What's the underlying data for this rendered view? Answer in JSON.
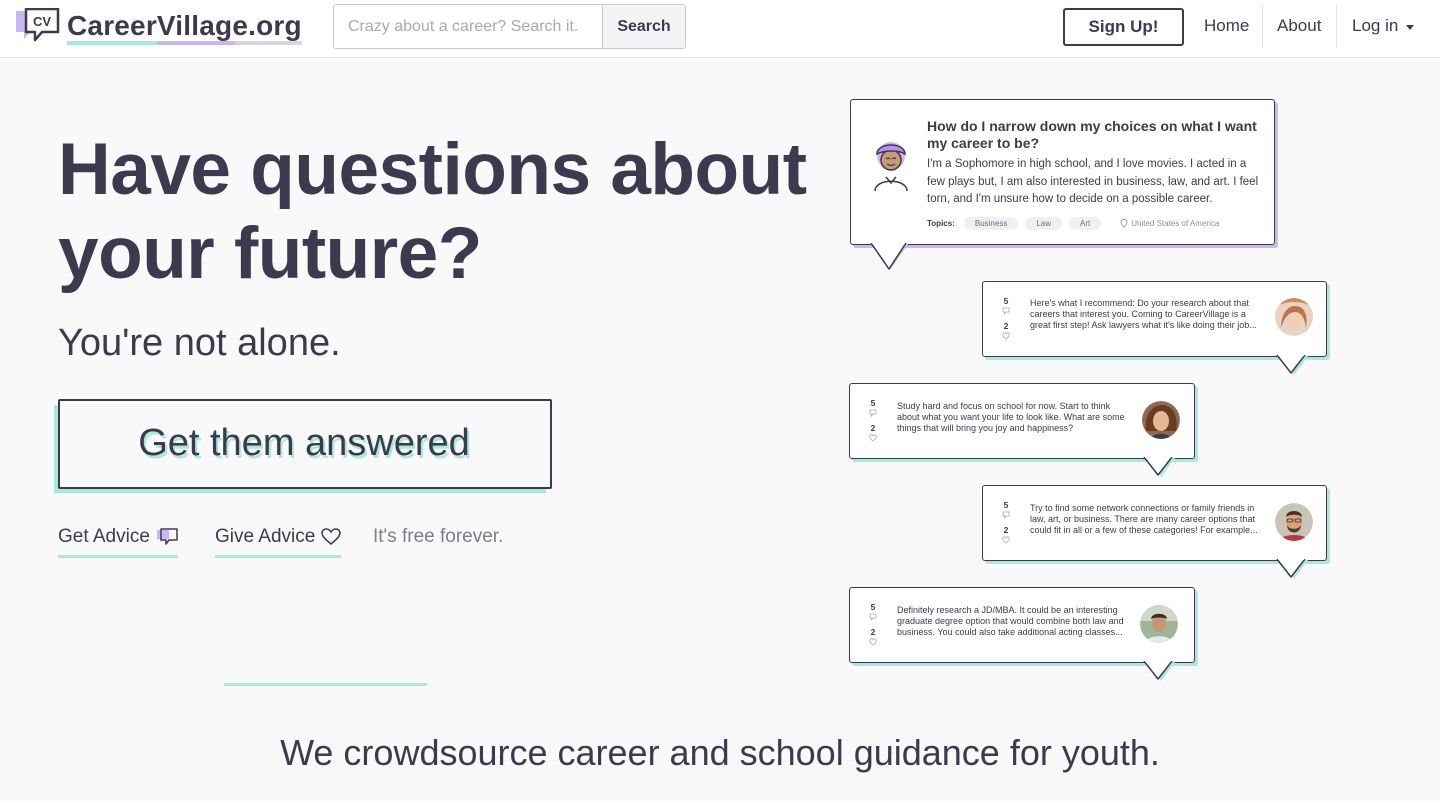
{
  "colors": {
    "brand_dark": "#3d3a4f",
    "accent_mint": "#a8ead8",
    "accent_purple": "#c9b8ef",
    "background": "#f9f9fa"
  },
  "header": {
    "logo_mark": "CV",
    "logo_text": "CareerVillage.org",
    "search_placeholder": "Crazy about a career? Search it.",
    "search_button": "Search",
    "signup": "Sign Up!",
    "nav_home": "Home",
    "nav_about": "About",
    "nav_login": "Log in"
  },
  "hero": {
    "title": "Have questions about your future?",
    "subtitle": "You're not alone.",
    "cta": "Get them answered",
    "get_advice": "Get Advice",
    "give_advice": "Give Advice",
    "free": "It's free forever."
  },
  "question_card": {
    "title": "How do I narrow down my choices on what I want my career to be?",
    "body": "I'm a Sophomore in high school, and I love movies. I acted in a few plays but, I am also interested in business, law, and art. I feel torn, and I'm unsure how to decide on a possible career.",
    "topics_label": "Topics:",
    "topics": [
      "Business",
      "Law",
      "Art"
    ],
    "location": "United States of America"
  },
  "answers": [
    {
      "comments": "5",
      "likes": "2",
      "text": "Here's what I recommend: Do your research about that careers that interest you. Coming to CareerVillage is a great first step! Ask lawyers what it's like doing their job..."
    },
    {
      "comments": "5",
      "likes": "2",
      "text": "Study hard and focus on school for now. Start to think about what you want your life to look like. What are some things that will bring you joy and happiness?"
    },
    {
      "comments": "5",
      "likes": "2",
      "text": "Try to find some network connections or family friends in law, art, or business. There are many career options that could fit in all or a few of these categories! For example..."
    },
    {
      "comments": "5",
      "likes": "2",
      "text": "Definitely research a JD/MBA. It could be an interesting graduate degree option that would combine both law and business. You could also take additional acting classes..."
    }
  ],
  "mission": "We crowdsource career and school guidance for youth.",
  "icons": [
    "cv-logo-icon",
    "speech-bubble-icon",
    "heart-icon",
    "comment-icon",
    "location-pin-icon",
    "caret-down-icon"
  ]
}
